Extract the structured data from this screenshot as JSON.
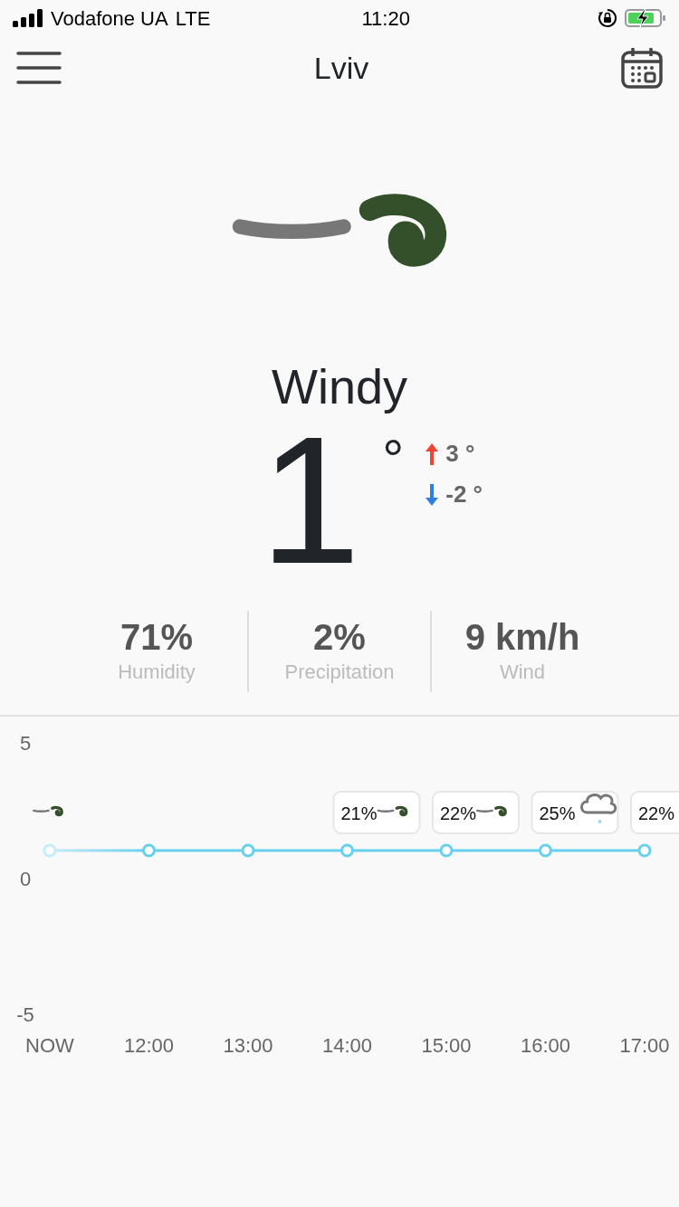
{
  "status_bar": {
    "carrier": "Vodafone UA",
    "network": "LTE",
    "time": "11:20"
  },
  "header": {
    "title": "Lviv"
  },
  "current": {
    "condition": "Windy",
    "temperature": "1",
    "unit": "°",
    "high": "3 °",
    "low": "-2 °"
  },
  "stats": [
    {
      "value": "71%",
      "label": "Humidity"
    },
    {
      "value": "2%",
      "label": "Precipitation"
    },
    {
      "value": "9 km/h",
      "label": "Wind"
    }
  ],
  "hourly": [
    {
      "kind": "wind"
    },
    {
      "kind": "none"
    },
    {
      "kind": "none"
    },
    {
      "kind": "wind-badge",
      "precip": "21%"
    },
    {
      "kind": "wind-badge",
      "precip": "22%"
    },
    {
      "kind": "snow-badge",
      "precip": "25%"
    },
    {
      "kind": "badge",
      "precip": "22%"
    }
  ],
  "chart_data": {
    "type": "line",
    "categories": [
      "NOW",
      "12:00",
      "13:00",
      "14:00",
      "15:00",
      "16:00",
      "17:00"
    ],
    "series": [
      {
        "color": "#66d0ee",
        "marker": "o",
        "values": [
          1,
          1,
          1,
          1,
          1,
          1,
          1
        ]
      }
    ],
    "ylim": [
      -5,
      5
    ],
    "yticks": [
      -5,
      0,
      5
    ]
  }
}
